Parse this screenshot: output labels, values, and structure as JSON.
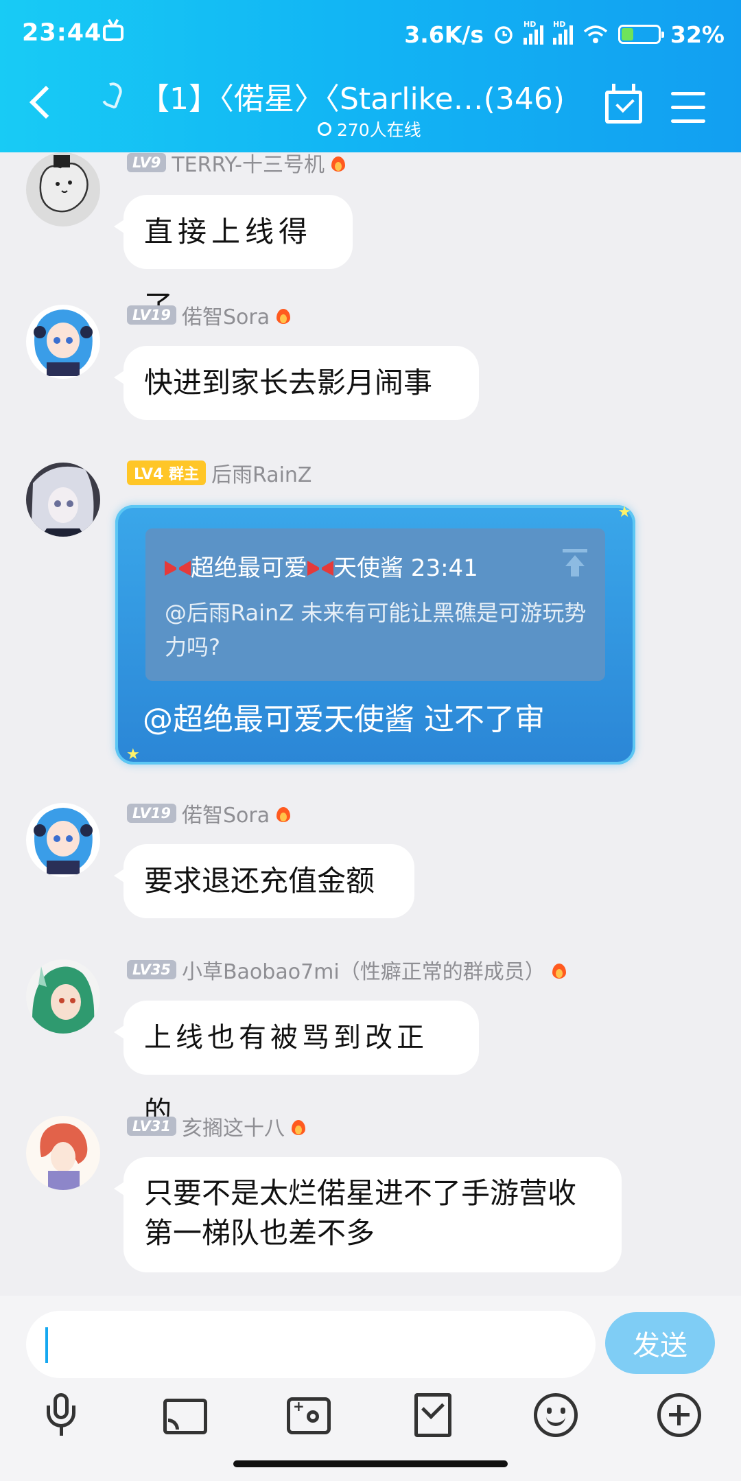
{
  "status_bar": {
    "time": "23:44",
    "speed": "3.6K/s",
    "battery": "32%",
    "hd_label": "HD",
    "battery_level": 0.32
  },
  "header": {
    "title": "【1】〈偌星〉〈Starlike…(346)",
    "online": "270人在线"
  },
  "messages": [
    {
      "level": "LV9",
      "name": "TERRY-十三号机",
      "text": "直接上线得了"
    },
    {
      "level": "LV19",
      "name": "偌智Sora",
      "text": "快进到家长去影月闹事"
    },
    {
      "level": "LV4",
      "role": "群主",
      "name": "后雨RainZ",
      "quote": {
        "sender": "超绝最可爱",
        "sender2": "天使酱 23:41",
        "body": "@后雨RainZ 未来有可能让黑礁是可游玩势力吗?"
      },
      "text": "@超绝最可爱天使酱 过不了审"
    },
    {
      "level": "LV19",
      "name": "偌智Sora",
      "text": "要求退还充值金额"
    },
    {
      "level": "LV35",
      "name": "小草Baobao7mi（性癖正常的群成员）",
      "text": "上线也有被骂到改正的"
    },
    {
      "level": "LV31",
      "name": "亥搁这十八",
      "text": "只要不是太烂偌星进不了手游营收第一梯队也差不多"
    }
  ],
  "composer": {
    "value": "",
    "send_label": "发送"
  },
  "toolbar": [
    "mic-icon",
    "screen-share-icon",
    "photo-icon",
    "red-packet-icon",
    "emoji-icon",
    "plus-icon"
  ],
  "colors": {
    "header_gradient": [
      "#18cbf5",
      "#129ff1"
    ],
    "background": "#efeff2",
    "owner_badge": "#ffc627",
    "level_badge": "#b7bcc9",
    "send_button": "#7fcdf5"
  }
}
